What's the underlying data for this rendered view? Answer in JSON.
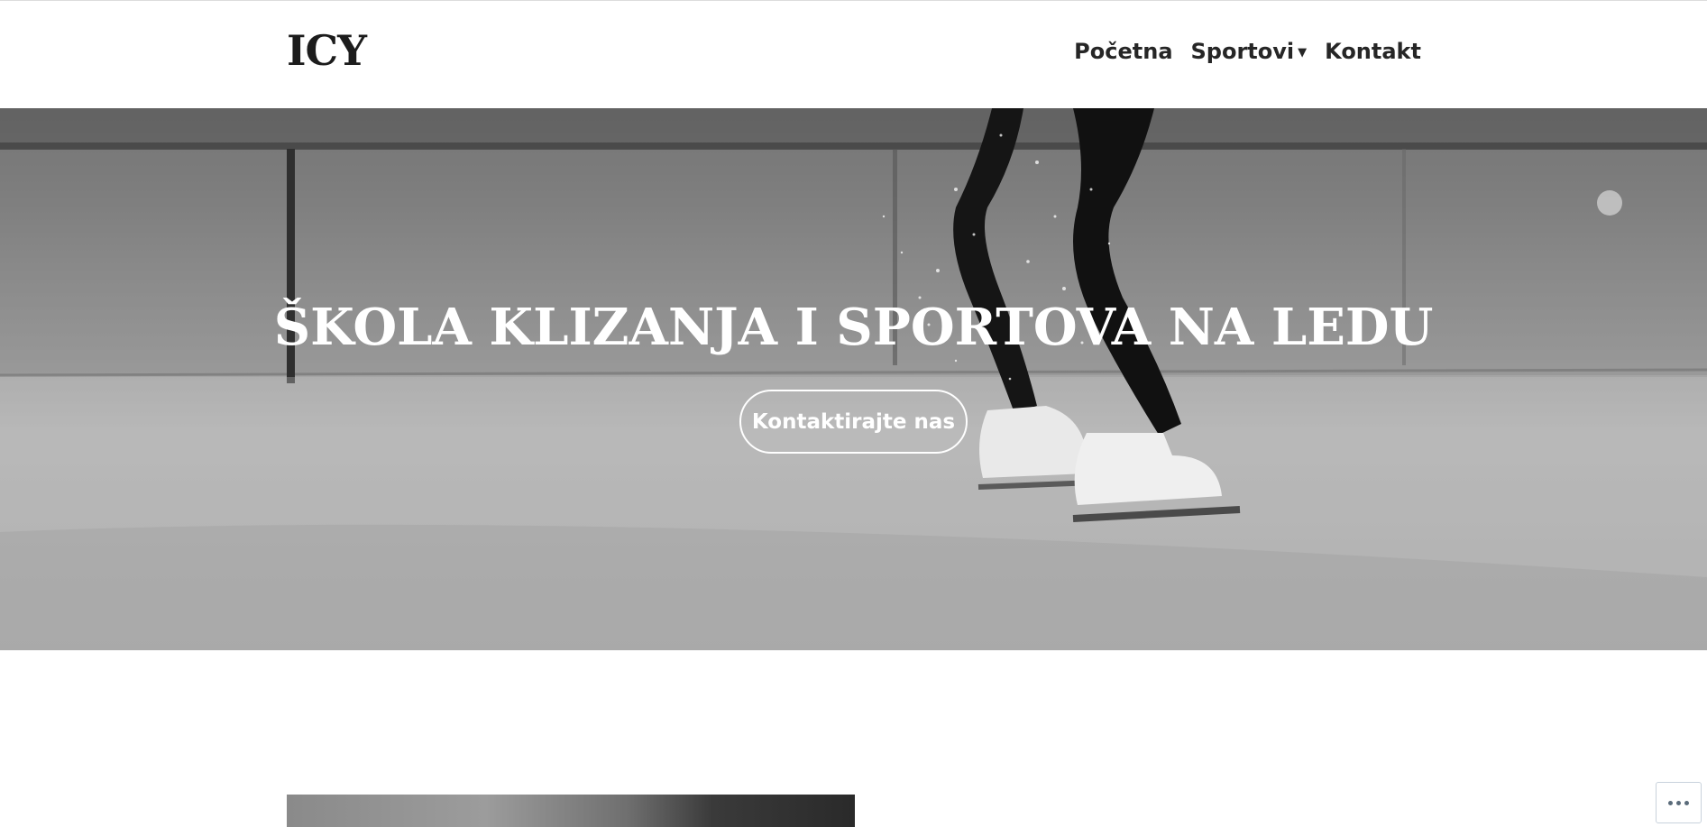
{
  "site": {
    "logo": "ICY"
  },
  "nav": {
    "items": [
      {
        "label": "Početna",
        "has_dropdown": false
      },
      {
        "label": "Sportovi",
        "has_dropdown": true
      },
      {
        "label": "Kontakt",
        "has_dropdown": false
      }
    ]
  },
  "hero": {
    "title": "ŠKOLA KLIZANJA I SPORTOVA NA LEDU",
    "button_label": "Kontaktirajte nas",
    "image": "ice-skater-legs-grayscale"
  },
  "content": {
    "image": "skating-photo-grayscale"
  },
  "actions": {
    "more_icon": "ellipsis-icon"
  },
  "colors": {
    "text": "#262626",
    "hero_text": "#ffffff",
    "background": "#ffffff"
  }
}
